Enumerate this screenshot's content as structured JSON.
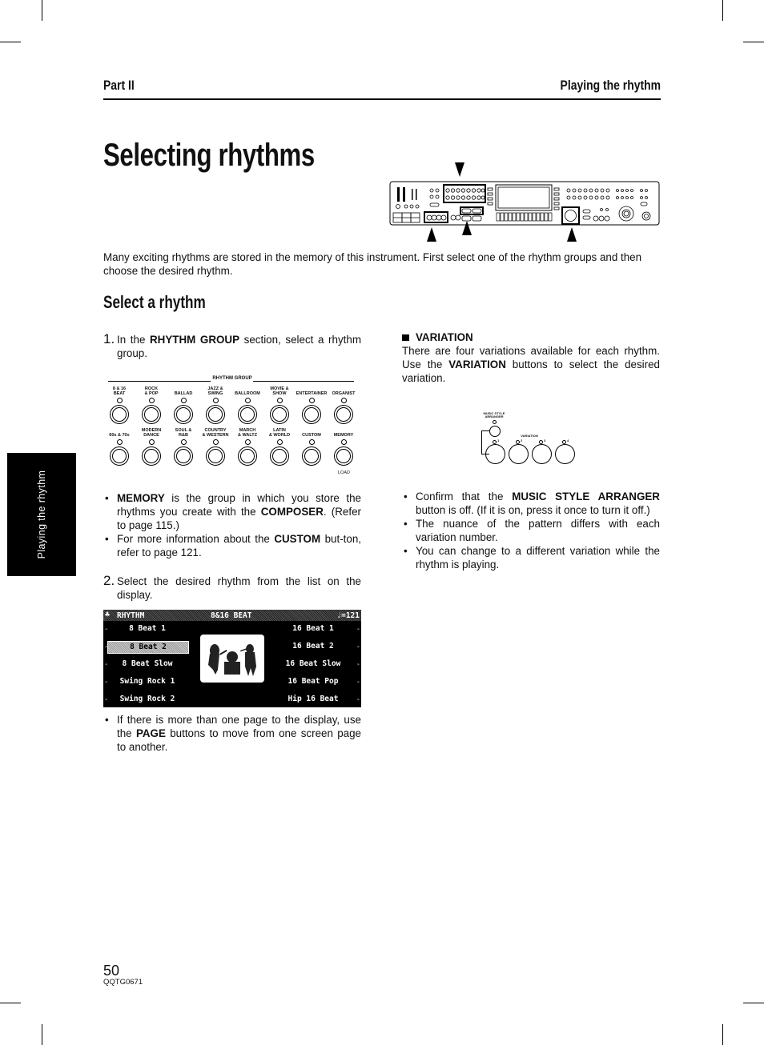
{
  "header": {
    "part": "Part II",
    "section": "Playing the rhythm"
  },
  "title": "Selecting rhythms",
  "intro": "Many exciting rhythms are stored in the memory of this instrument. First select one of the rhythm groups and then choose the desired rhythm.",
  "subheading": "Select a rhythm",
  "left_column": {
    "step1": {
      "number": "1.",
      "pre": "In the ",
      "bold": "RHYTHM GROUP",
      "post": " section, select a rhythm group."
    },
    "rhythm_group_panel": {
      "title": "RHYTHM GROUP",
      "top_row": [
        "8 & 16\nBEAT",
        "ROCK\n& POP",
        "BALLAD",
        "JAZZ &\nSWING",
        "BALLROOM",
        "MOVIE &\nSHOW",
        "ENTERTAINER",
        "ORGANIST"
      ],
      "bottom_row": [
        "60s & 70s",
        "MODERN\nDANCE",
        "SOUL &\nR&B",
        "COUNTRY\n& WESTERN",
        "MARCH\n& WALTZ",
        "LATIN\n& WORLD",
        "CUSTOM",
        "MEMORY"
      ],
      "load_label": "LOAD"
    },
    "notes1": [
      {
        "bold": "MEMORY",
        "text": " is the group in which you store the rhythms you create with the ",
        "bold2": "COMPOSER",
        "text2": ". (Refer to page 115.)"
      },
      {
        "pre": "For more information about the ",
        "bold": "CUSTOM",
        "text": " but-ton, refer to page 121."
      }
    ],
    "step2": {
      "number": "2.",
      "text": "Select the desired rhythm from the list on the display."
    },
    "display": {
      "header_left": "RHYTHM",
      "header_center": "8&16 BEAT",
      "header_right": "♩=121",
      "left_items": [
        "8 Beat 1",
        "8 Beat 2",
        "8 Beat Slow",
        "Swing Rock 1",
        "Swing Rock 2"
      ],
      "right_items": [
        "16 Beat 1",
        "16 Beat 2",
        "16 Beat Slow",
        "16 Beat Pop",
        "Hip 16 Beat"
      ],
      "selected_item": "8 Beat 2"
    },
    "notes2": [
      {
        "pre": "If there is more than one page to the display, use the ",
        "bold": "PAGE",
        "text": " buttons to move from one screen page to another."
      }
    ]
  },
  "right_column": {
    "variation_heading": "VARIATION",
    "variation_text": {
      "pre": "There are four variations available for each rhythm. Use the ",
      "bold": "VARIATION",
      "post": " buttons to select the desired variation."
    },
    "variation_panel": {
      "msa_label": "MUSIC STYLE\nARRANGER",
      "variation_label": "VARIATION",
      "numbers": [
        "1",
        "2",
        "3",
        "4"
      ]
    },
    "notes": [
      {
        "pre": "Confirm that the ",
        "bold": "MUSIC STYLE ARRANGER",
        "text": " button is off. (If it is on, press it once to turn it off.)"
      },
      {
        "pre": "",
        "bold": "",
        "text": "The nuance of the pattern differs with each variation number."
      },
      {
        "pre": "",
        "bold": "",
        "text": "You can change to a different variation while the rhythm is playing."
      }
    ]
  },
  "side_tab": "Playing the rhythm",
  "footer": {
    "page_number": "50",
    "doc_code": "QQTG0671"
  }
}
